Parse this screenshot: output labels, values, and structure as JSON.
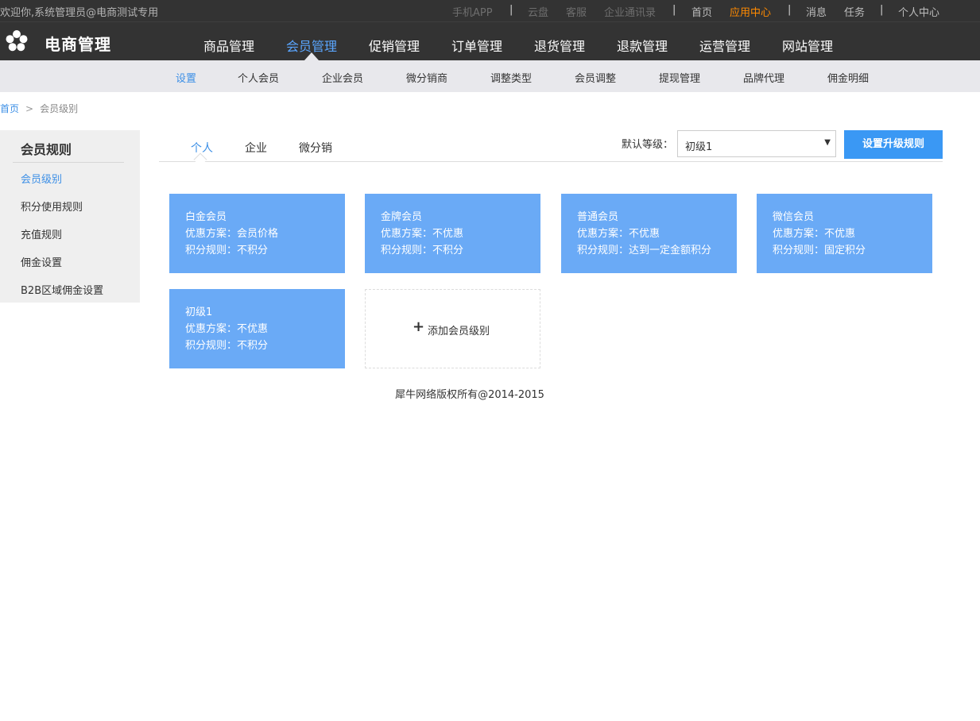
{
  "topbar": {
    "welcome": "欢迎你,系统管理员@电商测试专用",
    "links": {
      "mobile_app": "手机APP",
      "sep1": "|",
      "cloud": "云盘",
      "service": "客服",
      "contacts": "企业通讯录",
      "sep2": "|",
      "home": "首页",
      "app_center": "应用中心",
      "sep3": "|",
      "messages": "消息",
      "tasks": "任务",
      "sep4": "|",
      "personal": "个人中心"
    }
  },
  "header": {
    "brand": "电商管理",
    "nav": [
      "商品管理",
      "会员管理",
      "促销管理",
      "订单管理",
      "退货管理",
      "退款管理",
      "运营管理",
      "网站管理"
    ]
  },
  "subnav": [
    "设置",
    "个人会员",
    "企业会员",
    "微分销商",
    "调整类型",
    "会员调整",
    "提现管理",
    "品牌代理",
    "佣金明细"
  ],
  "breadcrumb": {
    "home": "首页",
    "separator": ">",
    "current": "会员级别"
  },
  "sidebar": {
    "title": "会员规则",
    "items": [
      "会员级别",
      "积分使用规则",
      "充值规则",
      "佣金设置",
      "B2B区域佣金设置"
    ]
  },
  "tabs": [
    "个人",
    "企业",
    "微分销"
  ],
  "default_level": {
    "label": "默认等级：",
    "value": "初级1",
    "arrow": "▼"
  },
  "upgrade_button": "设置升级规则",
  "cards": [
    {
      "name": "白金会员",
      "discount": "优惠方案：会员价格",
      "points": "积分规则：不积分"
    },
    {
      "name": "金牌会员",
      "discount": "优惠方案：不优惠",
      "points": "积分规则：不积分"
    },
    {
      "name": "普通会员",
      "discount": "优惠方案：不优惠",
      "points": "积分规则：达到一定金额积分"
    },
    {
      "name": "微信会员",
      "discount": "优惠方案：不优惠",
      "points": "积分规则：固定积分"
    },
    {
      "name": "初级1",
      "discount": "优惠方案：不优惠",
      "points": "积分规则：不积分"
    }
  ],
  "add_card": {
    "plus": "+",
    "label": "添加会员级别"
  },
  "footer": "犀牛网络版权所有@2014-2015",
  "colors": {
    "topbar": "#333333",
    "accent": "#3c8fe6",
    "card": "#6aaaf6",
    "button": "#3a98f4",
    "highlight": "#ff8a00"
  }
}
